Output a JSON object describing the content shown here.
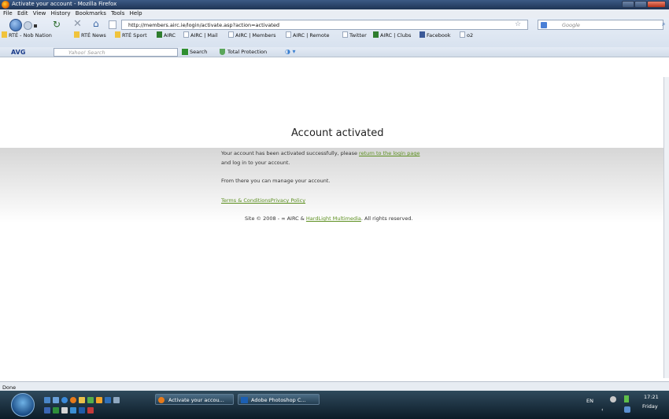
{
  "window": {
    "title": "Activate your account - Mozilla Firefox"
  },
  "menu": [
    "File",
    "Edit",
    "View",
    "History",
    "Bookmarks",
    "Tools",
    "Help"
  ],
  "nav": {
    "url": "http://members.airc.ie/login/activate.asp?action=activated",
    "search_placeholder": "Google"
  },
  "bookmarks": [
    {
      "label": "RTÉ - Nob Nation",
      "icon": "folder-icon"
    },
    {
      "label": "RTÉ News",
      "icon": "folder-icon"
    },
    {
      "label": "RTÉ Sport",
      "icon": "folder-icon"
    },
    {
      "label": "AIRC",
      "icon": "airc-icon"
    },
    {
      "label": "AIRC | Mail",
      "icon": "page-icon"
    },
    {
      "label": "AIRC | Members",
      "icon": "page-icon"
    },
    {
      "label": "AIRC | Remote",
      "icon": "page-icon"
    },
    {
      "label": "Twitter",
      "icon": "page-icon"
    },
    {
      "label": "AIRC | Clubs",
      "icon": "airc-icon"
    },
    {
      "label": "Facebook",
      "icon": "facebook-icon"
    },
    {
      "label": "o2",
      "icon": "page-icon"
    }
  ],
  "avg": {
    "brand": "AVG",
    "search_placeholder": "Yahoo! Search",
    "search_button": "Search",
    "protection_button": "Total Protection"
  },
  "page": {
    "heading": "Account activated",
    "msg_part1": "Your account has been activated successfully, please ",
    "msg_link": "return to the login page",
    "msg_line2": "and log in to your account.",
    "manage": "From there you can manage your account.",
    "terms": "Terms & Conditions",
    "privacy": "Privacy Policy",
    "footer_prefix": "Site © 2008 - ∞ AIRC & ",
    "footer_link": "HardLight Multimedia",
    "footer_suffix": ". All rights reserved."
  },
  "status": {
    "text": "Done"
  },
  "taskbar": {
    "buttons": [
      {
        "label": "Activate your accou...",
        "icon": "firefox-icon"
      },
      {
        "label": "Adobe Photoshop C...",
        "icon": "photoshop-icon"
      }
    ],
    "lang": "EN",
    "time": "17:21",
    "day": "Friday"
  },
  "colors": {
    "link": "#5b8e1e",
    "titlebar": "#2c4a74",
    "taskbar": "#1a3040"
  }
}
